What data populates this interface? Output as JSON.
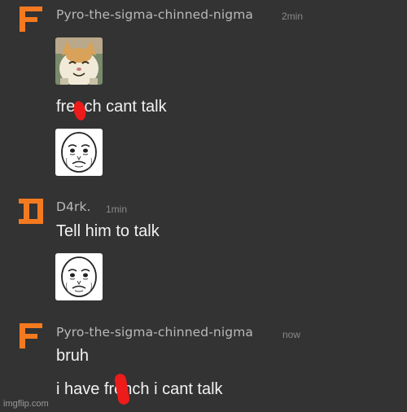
{
  "messages": [
    {
      "username": "Pyro-the-sigma-chinned-nigma",
      "timestamp": "2min",
      "avatar_icon": "letter-f-pixel-icon",
      "avatar_color": "#f47a20",
      "stickers": [
        "smiling-cat-sticker",
        "okay-rage-face-sticker"
      ],
      "text": "french cant talk"
    },
    {
      "username": "D4rk.",
      "timestamp": "1min",
      "avatar_icon": "letter-d-pixel-icon",
      "avatar_color": "#f47a20",
      "text": "Tell him to talk",
      "stickers": [
        "okay-rage-face-sticker"
      ]
    },
    {
      "username": "Pyro-the-sigma-chinned-nigma",
      "timestamp": "now",
      "avatar_icon": "letter-f-pixel-icon",
      "avatar_color": "#f47a20",
      "text_lines": [
        "bruh",
        "i have french i cant talk"
      ]
    }
  ],
  "watermark": "imgflip.com",
  "colors": {
    "background": "#333333",
    "username": "#b9b9b9",
    "timestamp": "#8a8a8a",
    "message": "#f2f2f2",
    "scribble": "#ee1b1b"
  }
}
